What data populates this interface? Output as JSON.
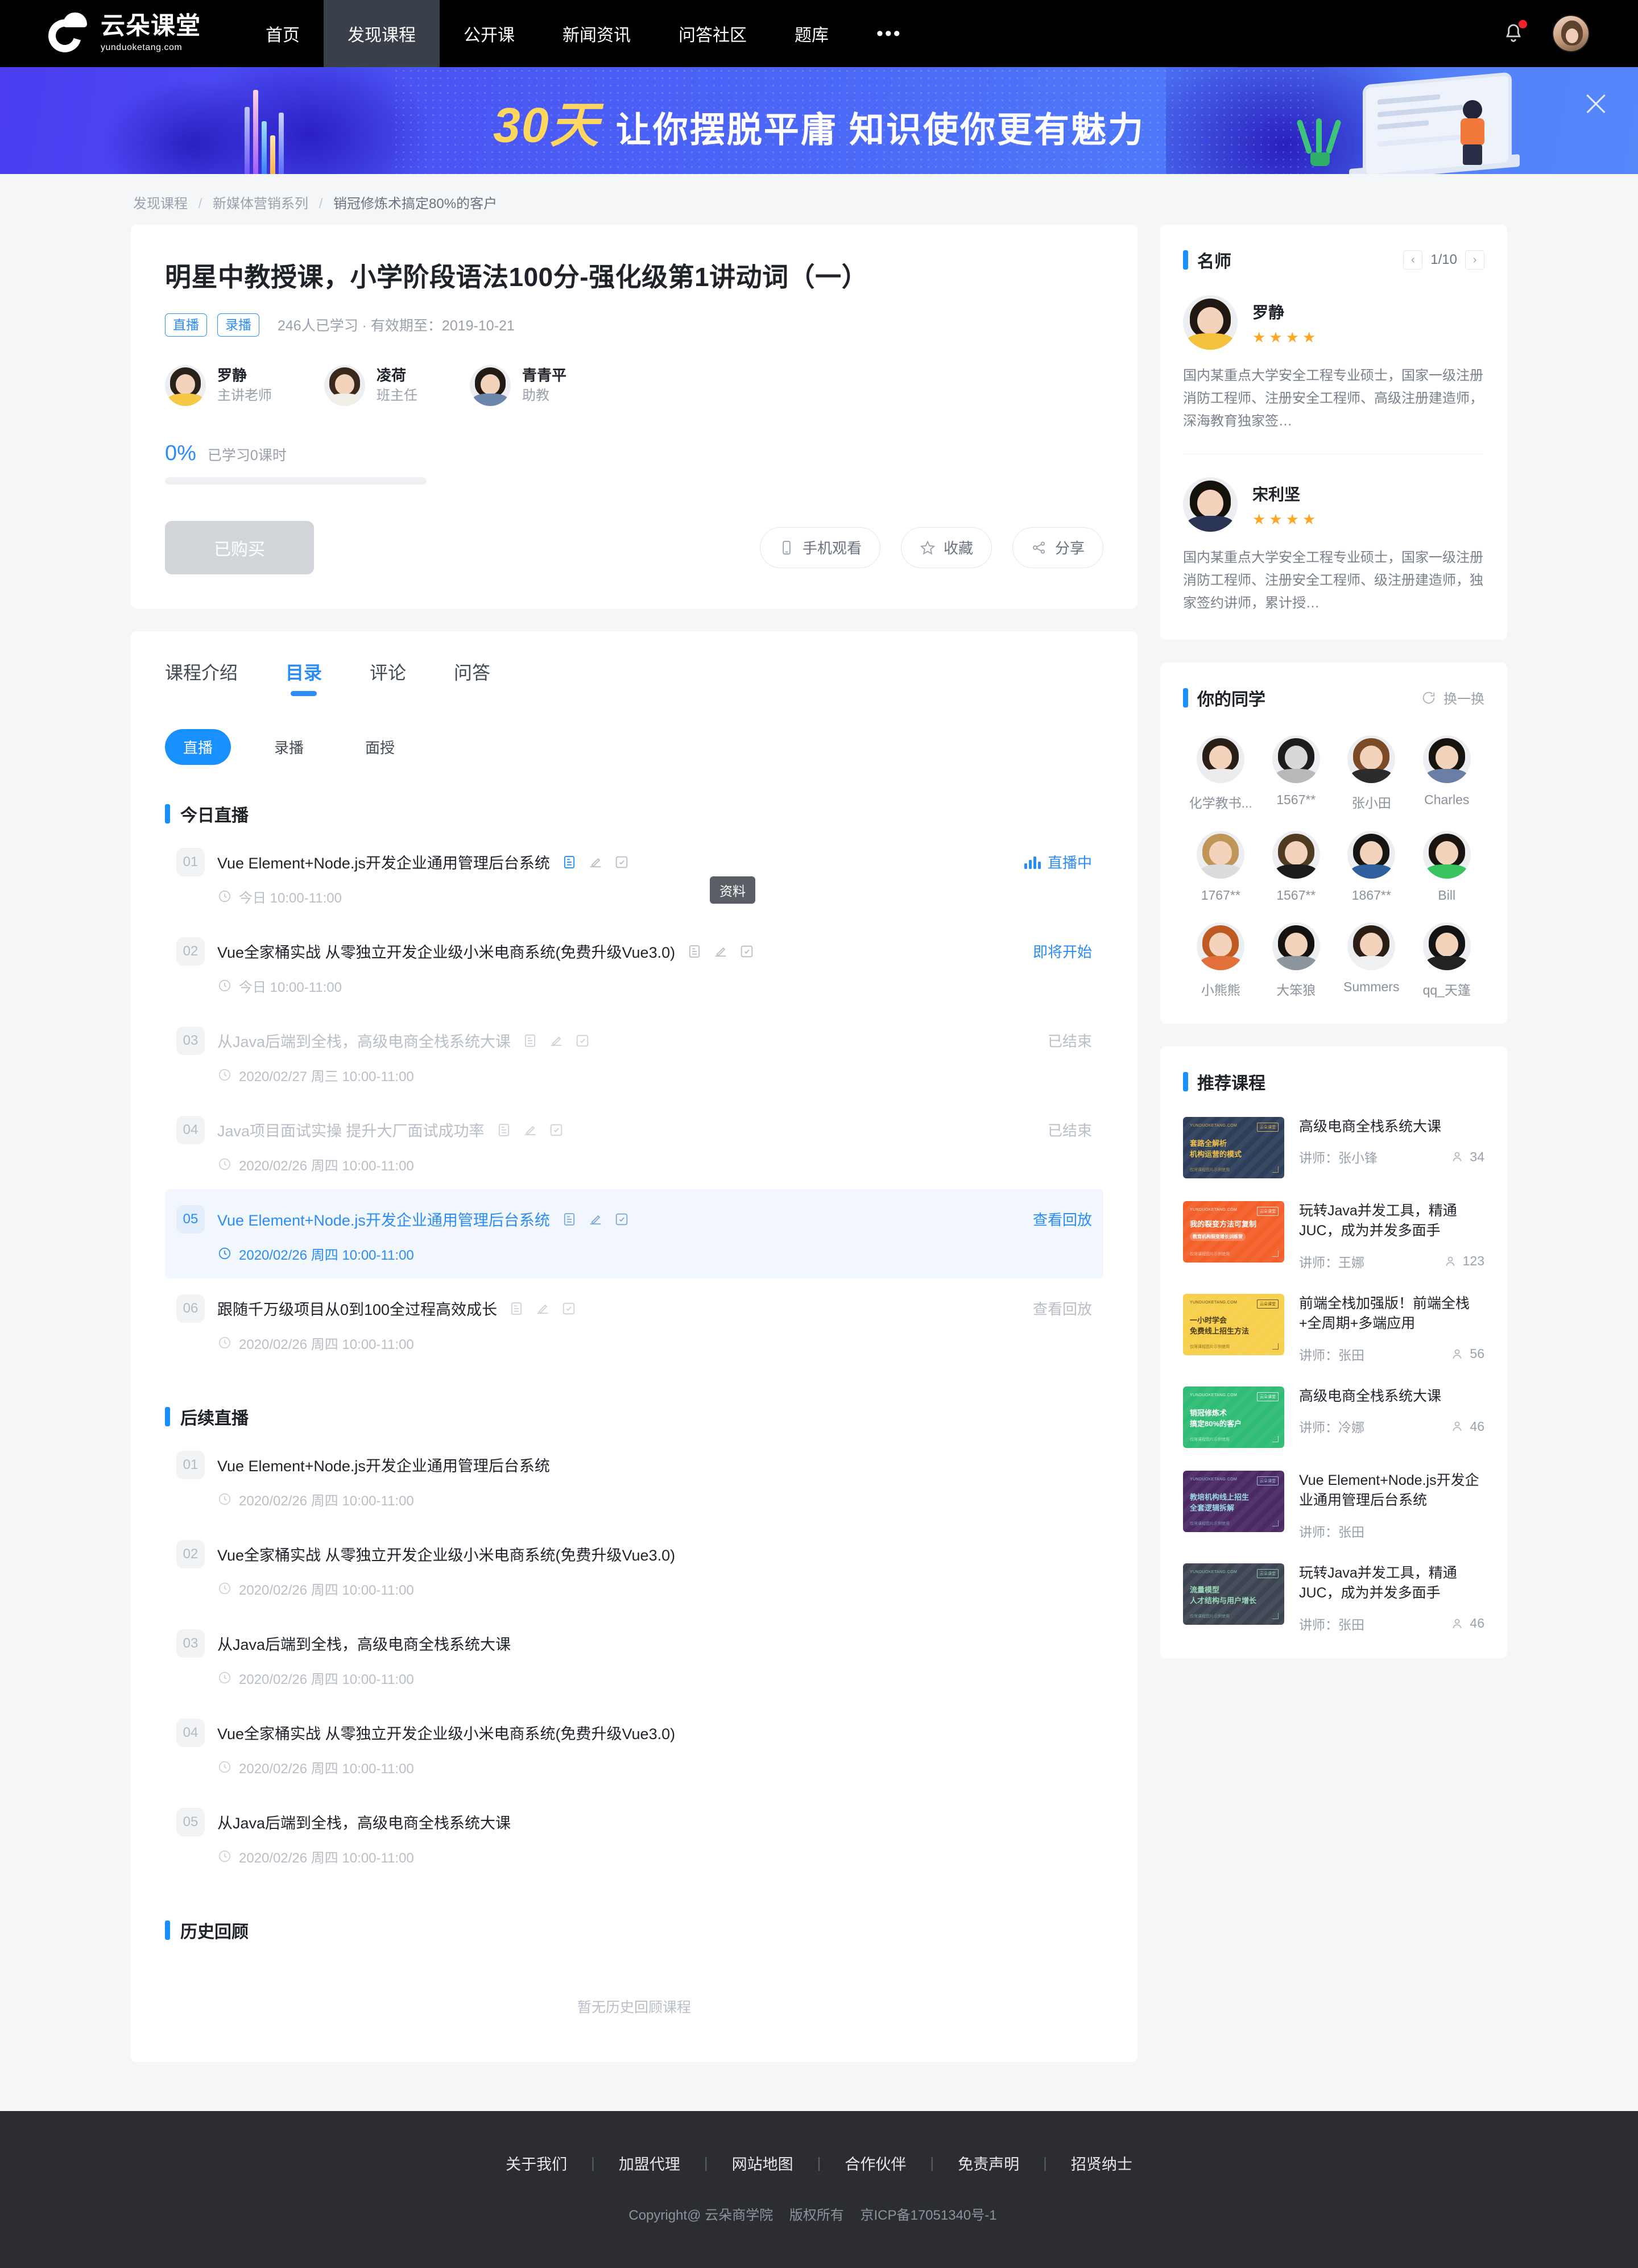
{
  "nav": {
    "logo_cn": "云朵课堂",
    "logo_en": "yunduoketang.com",
    "items": [
      {
        "label": "首页",
        "active": false
      },
      {
        "label": "发现课程",
        "active": true
      },
      {
        "label": "公开课",
        "active": false
      },
      {
        "label": "新闻资讯",
        "active": false
      },
      {
        "label": "问答社区",
        "active": false
      },
      {
        "label": "题库",
        "active": false
      }
    ],
    "more": "•••"
  },
  "banner": {
    "highlight": "30天",
    "text": "让你摆脱平庸  知识使你更有魅力"
  },
  "breadcrumb": {
    "first": "发现课程",
    "second": "新媒体营销系列",
    "last": "销冠修炼术搞定80%的客户"
  },
  "course": {
    "title": "明星中教授课，小学阶段语法100分-强化级第1讲动词（一）",
    "tags": [
      "直播",
      "录播"
    ],
    "meta": "246人已学习 · 有效期至：2019-10-21",
    "teachers": [
      {
        "name": "罗静",
        "role": "主讲老师"
      },
      {
        "name": "凌荷",
        "role": "班主任"
      },
      {
        "name": "青青平",
        "role": "助教"
      }
    ],
    "progress_pct": "0%",
    "progress_label": "已学习0课时",
    "progress_value": 0,
    "buy_button": "已购买",
    "actions": [
      {
        "label": "手机观看",
        "icon": "phone-icon"
      },
      {
        "label": "收藏",
        "icon": "star-icon"
      },
      {
        "label": "分享",
        "icon": "share-icon"
      }
    ]
  },
  "catalog": {
    "tabs": [
      {
        "label": "课程介绍",
        "active": false
      },
      {
        "label": "目录",
        "active": true
      },
      {
        "label": "评论",
        "active": false
      },
      {
        "label": "问答",
        "active": false
      }
    ],
    "chips": [
      {
        "label": "直播",
        "active": true
      },
      {
        "label": "录播",
        "active": false
      },
      {
        "label": "面授",
        "active": false
      }
    ],
    "tooltip": "资料",
    "sections": [
      {
        "title": "今日直播",
        "lessons": [
          {
            "no": "01",
            "name": "Vue Element+Node.js开发企业通用管理后台系统",
            "time": "今日 10:00-11:00",
            "status": "直播中",
            "state": "live",
            "icons": true
          },
          {
            "no": "02",
            "name": "Vue全家桶实战 从零独立开发企业级小米电商系统(免费升级Vue3.0)",
            "time": "今日 10:00-11:00",
            "status": "即将开始",
            "state": "soon",
            "icons": true
          },
          {
            "no": "03",
            "name": "从Java后端到全栈，高级电商全栈系统大课",
            "time": "2020/02/27 周三 10:00-11:00",
            "status": "已结束",
            "state": "ended",
            "icons": true
          },
          {
            "no": "04",
            "name": "Java项目面试实操 提升大厂面试成功率",
            "time": "2020/02/26 周四 10:00-11:00",
            "status": "已结束",
            "state": "ended",
            "icons": true
          },
          {
            "no": "05",
            "name": "Vue Element+Node.js开发企业通用管理后台系统",
            "time": "2020/02/26 周四 10:00-11:00",
            "status": "查看回放",
            "state": "highlight",
            "icons": true
          },
          {
            "no": "06",
            "name": "跟随千万级项目从0到100全过程高效成长",
            "time": "2020/02/26 周四 10:00-11:00",
            "status": "查看回放",
            "state": "ended",
            "icons": true
          }
        ]
      },
      {
        "title": "后续直播",
        "lessons": [
          {
            "no": "01",
            "name": "Vue Element+Node.js开发企业通用管理后台系统",
            "time": "2020/02/26 周四 10:00-11:00",
            "status": "",
            "state": "plain",
            "icons": false
          },
          {
            "no": "02",
            "name": "Vue全家桶实战 从零独立开发企业级小米电商系统(免费升级Vue3.0)",
            "time": "2020/02/26 周四 10:00-11:00",
            "status": "",
            "state": "plain",
            "icons": false
          },
          {
            "no": "03",
            "name": "从Java后端到全栈，高级电商全栈系统大课",
            "time": "2020/02/26 周四 10:00-11:00",
            "status": "",
            "state": "plain",
            "icons": false
          },
          {
            "no": "04",
            "name": "Vue全家桶实战 从零独立开发企业级小米电商系统(免费升级Vue3.0)",
            "time": "2020/02/26 周四 10:00-11:00",
            "status": "",
            "state": "plain",
            "icons": false
          },
          {
            "no": "05",
            "name": "从Java后端到全栈，高级电商全栈系统大课",
            "time": "2020/02/26 周四 10:00-11:00",
            "status": "",
            "state": "plain",
            "icons": false
          }
        ]
      },
      {
        "title": "历史回顾",
        "empty": "暂无历史回顾课程",
        "lessons": []
      }
    ]
  },
  "sidebar": {
    "masters": {
      "title": "名师",
      "page": "1/10",
      "prev": "‹",
      "next": "›",
      "items": [
        {
          "name": "罗静",
          "stars": 4,
          "desc": "国内某重点大学安全工程专业硕士，国家一级注册消防工程师、注册安全工程师、高级注册建造师，深海教育独家签…"
        },
        {
          "name": "宋利坚",
          "stars": 4,
          "desc": "国内某重点大学安全工程专业硕士，国家一级注册消防工程师、注册安全工程师、级注册建造师，独家签约讲师，累计授…"
        }
      ]
    },
    "classmates": {
      "title": "你的同学",
      "refresh": "换一换",
      "items": [
        {
          "name": "化学教书..."
        },
        {
          "name": "1567**"
        },
        {
          "name": "张小田"
        },
        {
          "name": "Charles"
        },
        {
          "name": "1767**"
        },
        {
          "name": "1567**"
        },
        {
          "name": "1867**"
        },
        {
          "name": "Bill"
        },
        {
          "name": "小熊熊"
        },
        {
          "name": "大笨狼"
        },
        {
          "name": "Summers"
        },
        {
          "name": "qq_天篷"
        }
      ]
    },
    "recommended": {
      "title": "推荐课程",
      "items": [
        {
          "title": "高级电商全栈系统大课",
          "teacher": "讲师：张小锋",
          "count": "34",
          "thumb_color": "#2e3f5c",
          "thumb_text_color": "#f0c04a",
          "thumb_line1": "套路全解析",
          "thumb_line2": "机构运营的模式",
          "thumb_logo": "YUNDUOKETANG.COM",
          "thumb_badge": "云朵课堂",
          "thumb_foot": "仅限课程图片示例使用"
        },
        {
          "title": "玩转Java并发工具，精通JUC，成为并发多面手",
          "teacher": "讲师：王娜",
          "count": "123",
          "thumb_color": "#f4602a",
          "thumb_text_color": "#ffffff",
          "thumb_line1": "我的裂变方法可复制",
          "thumb_line2": "教育机构裂变增长训练营",
          "thumb_logo": "YUNDUOKETANG.COM",
          "thumb_badge": "云朵课堂",
          "thumb_foot": "仅限课程图片示例使用"
        },
        {
          "title": "前端全栈加强版！前端全栈+全周期+多端应用",
          "teacher": "讲师：张田",
          "count": "56",
          "thumb_color": "#f7cf4a",
          "thumb_text_color": "#4a3a12",
          "thumb_line1": "一小时学会",
          "thumb_line2": "免费线上招生方法",
          "thumb_logo": "YUNDUOKETANG.COM",
          "thumb_badge": "云朵课堂",
          "thumb_foot": "仅限课程图片示例使用"
        },
        {
          "title": "高级电商全栈系统大课",
          "teacher": "讲师：冷娜",
          "count": "46",
          "thumb_color": "#2fbc74",
          "thumb_text_color": "#ffffff",
          "thumb_line1": "销冠修炼术",
          "thumb_line2": "搞定80%的客户",
          "thumb_logo": "YUNDUOKETANG.COM",
          "thumb_badge": "云朵课堂",
          "thumb_foot": "仅限课程图片示例使用"
        },
        {
          "title": "Vue Element+Node.js开发企业通用管理后台系统",
          "teacher": "讲师：张田",
          "count": "",
          "thumb_color": "#4b2a63",
          "thumb_text_color": "#9ad8e8",
          "thumb_line1": "教培机构线上招生",
          "thumb_line2": "全套逻辑拆解",
          "thumb_logo": "YUNDUOKETANG.COM",
          "thumb_badge": "云朵课堂",
          "thumb_foot": "仅限课程图片示例使用"
        },
        {
          "title": "玩转Java并发工具，精通JUC，成为并发多面手",
          "teacher": "讲师：张田",
          "count": "46",
          "thumb_color": "#3e4552",
          "thumb_text_color": "#9ad8b8",
          "thumb_line1": "流量模型",
          "thumb_line2": "人才结构与用户增长",
          "thumb_logo": "YUNDUOKETANG.COM",
          "thumb_badge": "云朵课堂",
          "thumb_foot": "仅限课程图片示例使用"
        }
      ]
    }
  },
  "footer": {
    "links": [
      "关于我们",
      "加盟代理",
      "网站地图",
      "合作伙伴",
      "免责声明",
      "招贤纳士"
    ],
    "copyright": "Copyright@ 云朵商学院",
    "rights": "版权所有",
    "icp": "京ICP备17051340号-1"
  },
  "colors": {
    "accent": "#1890ff",
    "nav_bg": "#000000",
    "banner_start": "#4b3cf0",
    "star": "#ffa624"
  }
}
